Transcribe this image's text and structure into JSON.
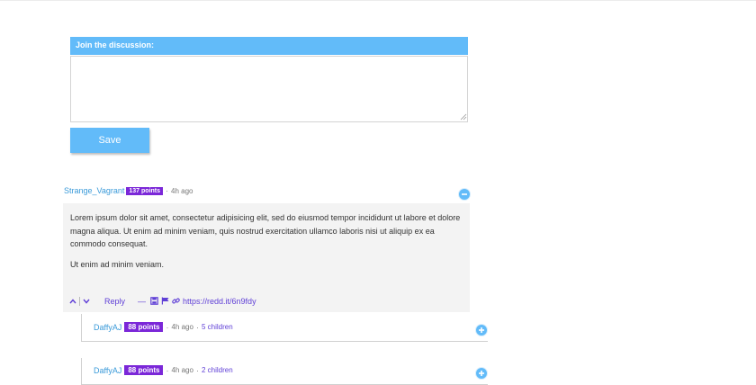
{
  "discussion": {
    "header": "Join the discussion:",
    "placeholder": "",
    "save_label": "Save"
  },
  "comment": {
    "author": "Strange_Vagrant",
    "points": "137 points",
    "separator": "·",
    "time": "4h ago",
    "paragraphs": [
      "Lorem ipsum dolor sit amet, consectetur adipisicing elit, sed do eiusmod tempor incididunt ut labore et dolore magna aliqua. Ut enim ad minim veniam, quis nostrud exercitation ullamco laboris nisi ut aliquip ex ea commodo consequat.",
      "Ut enim ad minim veniam."
    ],
    "actions": {
      "reply": "Reply",
      "dash": "—",
      "permalink": "https://redd.it/6n9fdy"
    }
  },
  "replies": [
    {
      "author": "DaffyAJ",
      "points": "88 points",
      "time": "4h ago",
      "children": "5 children"
    },
    {
      "author": "DaffyAJ",
      "points": "88 points",
      "time": "4h ago",
      "children": "2 children"
    }
  ],
  "colors": {
    "accent": "#62bbf9",
    "badge": "#7b27d8",
    "link": "#5f3fd6",
    "author": "#3a9ad9",
    "body_bg": "#f3f3f3"
  },
  "icons": {
    "upvote": "chevron-up-icon",
    "downvote": "chevron-down-icon",
    "save": "save-icon",
    "report": "flag-icon",
    "permalink": "link-icon",
    "collapse": "minus-circle-icon",
    "expand": "plus-circle-icon"
  }
}
